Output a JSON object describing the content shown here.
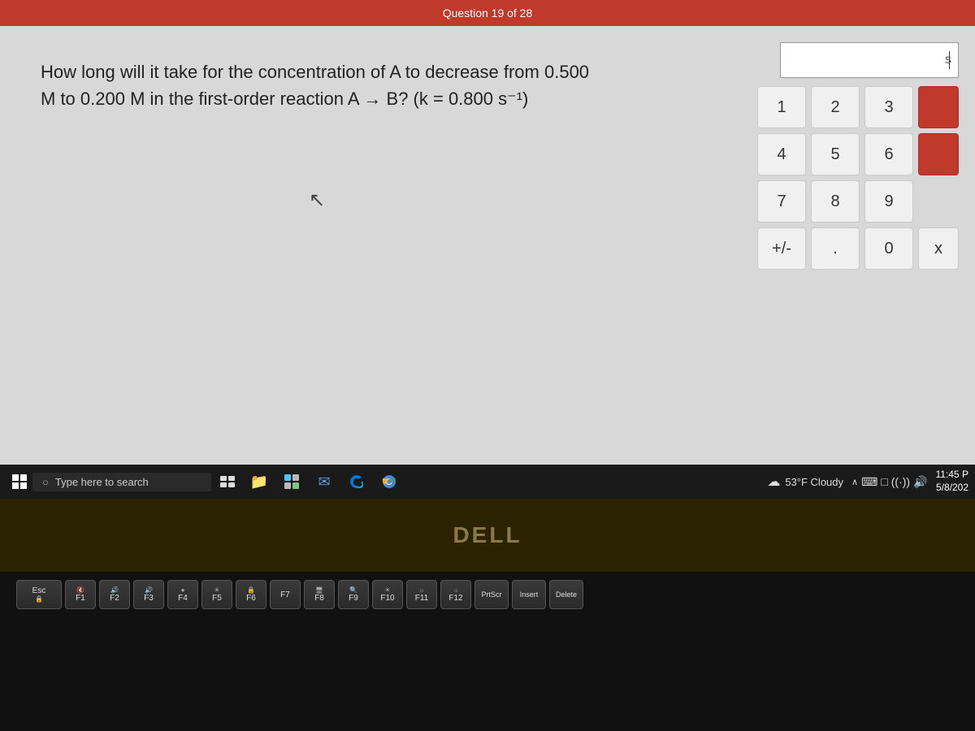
{
  "top_bar": {
    "text": "Question 19 of 28"
  },
  "question": {
    "text": "How long will it take for the concentration of A to decrease from 0.500 M to 0.200 M in the first-order reaction A → B? (k = 0.800 s⁻¹)",
    "line1": "How long will it take for the concentration of A to decrease from 0.500",
    "line2": "M to 0.200 M in the first-order reaction A → B? (k = 0.800 s⁻¹)"
  },
  "answer_display": {
    "unit": "s"
  },
  "numpad": {
    "buttons": [
      {
        "label": "1",
        "type": "normal"
      },
      {
        "label": "2",
        "type": "normal"
      },
      {
        "label": "3",
        "type": "normal"
      },
      {
        "label": "",
        "type": "red"
      },
      {
        "label": "4",
        "type": "normal"
      },
      {
        "label": "5",
        "type": "normal"
      },
      {
        "label": "6",
        "type": "normal"
      },
      {
        "label": "",
        "type": "red"
      },
      {
        "label": "7",
        "type": "normal"
      },
      {
        "label": "8",
        "type": "normal"
      },
      {
        "label": "9",
        "type": "normal"
      },
      {
        "label": "",
        "type": "hidden"
      },
      {
        "label": "+/-",
        "type": "normal"
      },
      {
        "label": ".",
        "type": "normal"
      },
      {
        "label": "0",
        "type": "normal"
      },
      {
        "label": "x",
        "type": "normal"
      }
    ]
  },
  "taskbar": {
    "search_placeholder": "Type here to search",
    "weather": "53°F Cloudy",
    "clock_time": "11:45 P",
    "clock_date": "5/8/202",
    "icons": {
      "windows": "⊞",
      "search": "○",
      "task_view": "⧉",
      "folder": "📁",
      "widgets": "⊞",
      "mail": "✉",
      "edge": "◉",
      "chrome": "●"
    }
  },
  "dell_logo": "DELL",
  "keyboard": {
    "row1": [
      "Esc",
      "F1",
      "F2",
      "F3",
      "F4",
      "F5",
      "F6",
      "F7",
      "F8",
      "F9",
      "F10",
      "F11",
      "F12",
      "PrtScr",
      "Insert",
      "Delete"
    ],
    "function_labels": {
      "F1": "🔇",
      "F2": "🔊",
      "F3": "🔊",
      "F4": "●",
      "F5": "🔒",
      "F6": "🔒",
      "F10": "🔍",
      "F11": "☀",
      "F12": "☀"
    }
  }
}
